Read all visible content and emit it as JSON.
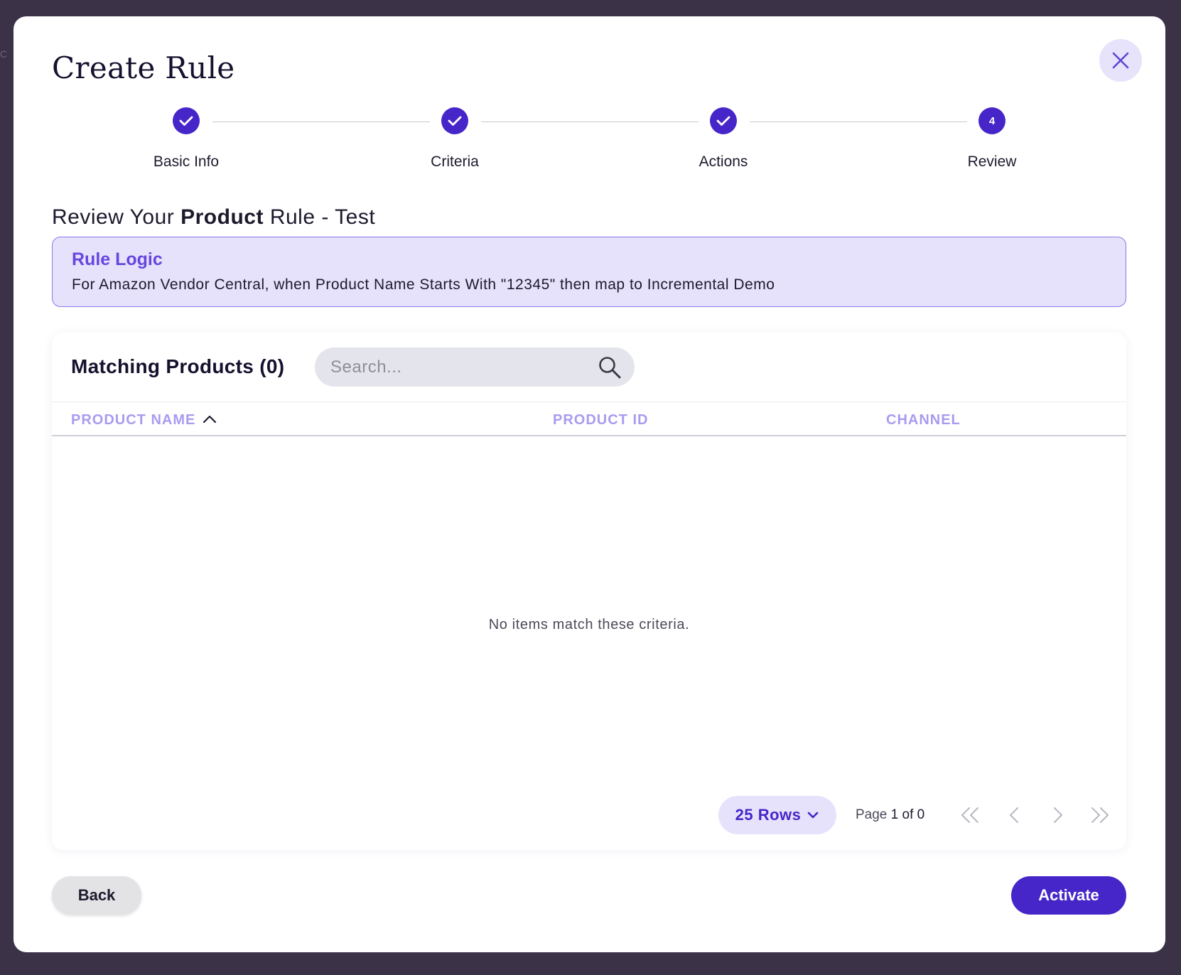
{
  "modal": {
    "title": "Create Rule"
  },
  "stepper": {
    "steps": [
      {
        "label": "Basic Info",
        "number": "1",
        "state": "complete"
      },
      {
        "label": "Criteria",
        "number": "2",
        "state": "complete"
      },
      {
        "label": "Actions",
        "number": "3",
        "state": "complete"
      },
      {
        "label": "Review",
        "number": "4",
        "state": "active"
      }
    ]
  },
  "review": {
    "prefix": "Review Your",
    "type": "Product",
    "suffix": "Rule - Test"
  },
  "rule_logic": {
    "title": "Rule Logic",
    "text": "For Amazon Vendor Central, when Product Name Starts With \"12345\" then map to Incremental Demo"
  },
  "table": {
    "title": "Matching Products (0)",
    "search_placeholder": "Search...",
    "columns": [
      {
        "label": "PRODUCT NAME",
        "sorted": "asc"
      },
      {
        "label": "PRODUCT ID"
      },
      {
        "label": "CHANNEL"
      }
    ],
    "empty_message": "No items match these criteria."
  },
  "pagination": {
    "rows_label": "25 Rows",
    "page_label": "Page",
    "current_page": "1",
    "of_label": "of",
    "total_pages": "0"
  },
  "footer": {
    "back_label": "Back",
    "activate_label": "Activate"
  },
  "colors": {
    "primary": "#4626c9",
    "accent_light": "#e6e2fc",
    "header_text": "#a99bf0",
    "backdrop": "#3b3248"
  }
}
